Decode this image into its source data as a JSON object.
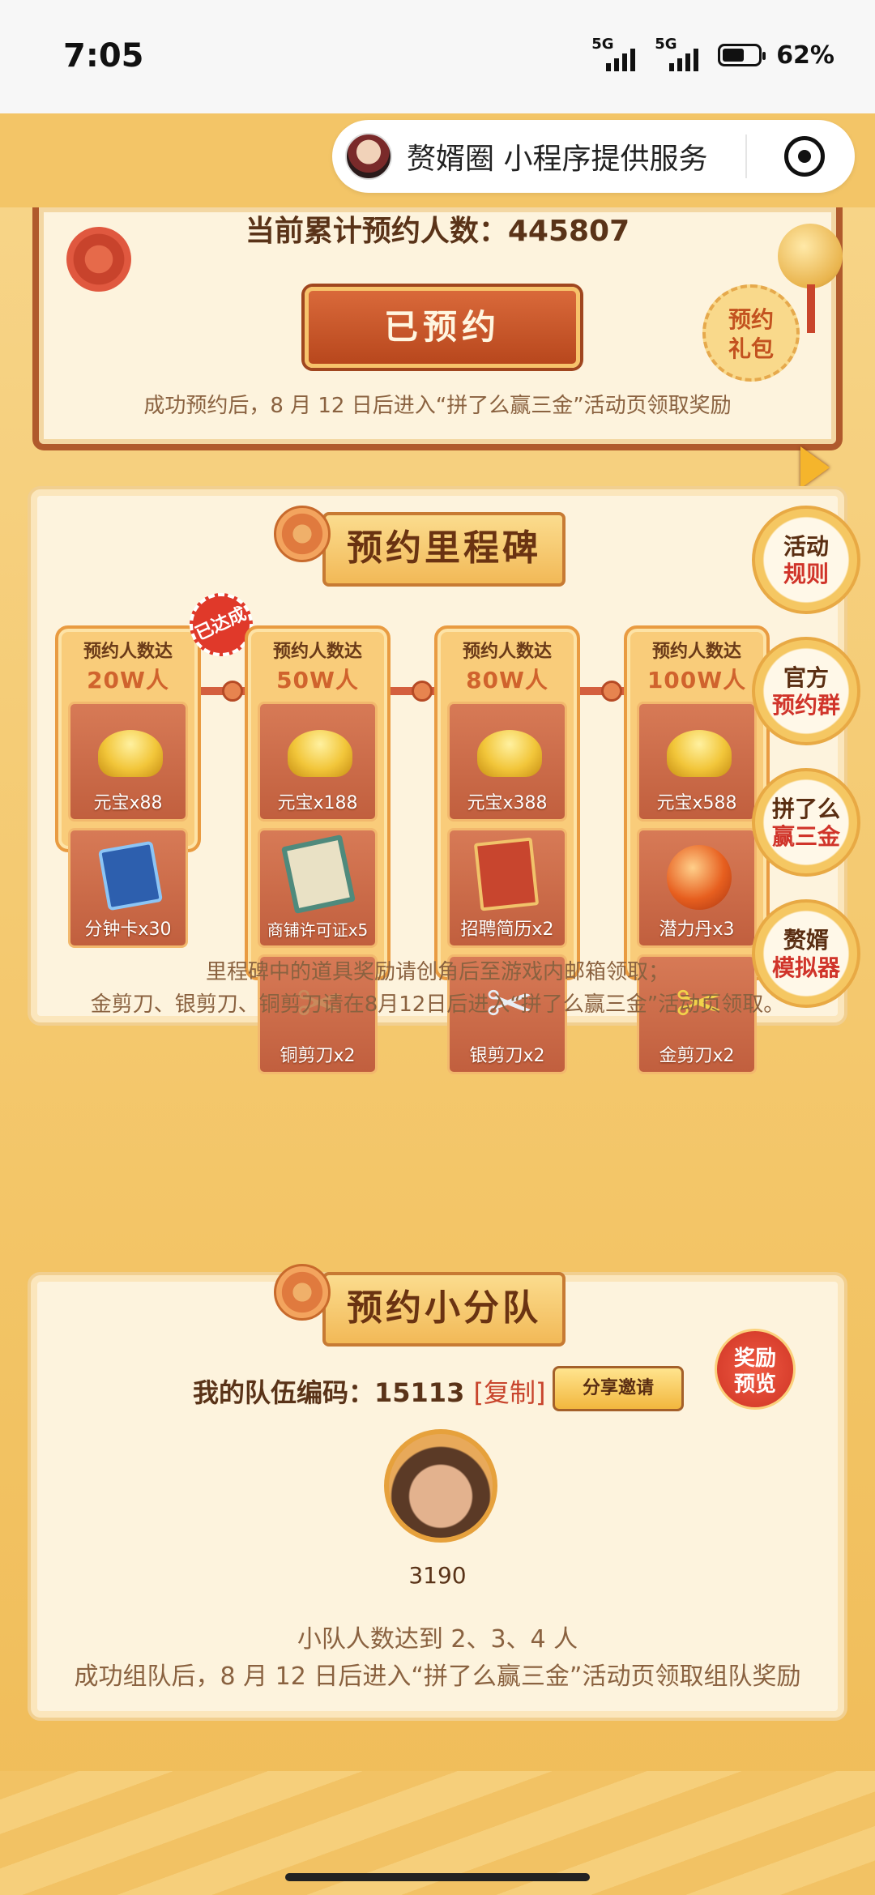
{
  "status_bar": {
    "time": "7:05",
    "signal1_label": "5G",
    "signal2_label": "5G",
    "battery_percent": "62%",
    "battery_level": 0.62
  },
  "mini_program": {
    "label": "赘婿圈 小程序提供服务"
  },
  "reservation": {
    "count_line": "当前累计预约人数：445807",
    "button_label": "已预约",
    "gift_badge_line1": "预约",
    "gift_badge_line2": "礼包",
    "note": "成功预约后，8 月 12 日后进入“拼了么赢三金”活动页领取奖励"
  },
  "milestone": {
    "title": "预约里程碑",
    "achieved_stamp": "已达成",
    "columns": [
      {
        "head_a": "预约人数达",
        "head_b": "20W人",
        "items": [
          {
            "icon": "gold-ingot-icon",
            "label": "元宝x88"
          },
          {
            "icon": "hourglass-card-icon",
            "label": "分钟卡x30"
          }
        ]
      },
      {
        "head_a": "预约人数达",
        "head_b": "50W人",
        "items": [
          {
            "icon": "gold-ingot-icon",
            "label": "元宝x188"
          },
          {
            "icon": "shop-license-icon",
            "label": "商铺许可证x5"
          },
          {
            "icon": "copper-scissors-icon",
            "label": "铜剪刀x2"
          }
        ]
      },
      {
        "head_a": "预约人数达",
        "head_b": "80W人",
        "items": [
          {
            "icon": "gold-ingot-icon",
            "label": "元宝x388"
          },
          {
            "icon": "resume-icon",
            "label": "招聘简历x2"
          },
          {
            "icon": "silver-scissors-icon",
            "label": "银剪刀x2"
          }
        ]
      },
      {
        "head_a": "预约人数达",
        "head_b": "100W人",
        "items": [
          {
            "icon": "gold-ingot-icon",
            "label": "元宝x588"
          },
          {
            "icon": "potential-pill-icon",
            "label": "潜力丹x3"
          },
          {
            "icon": "gold-scissors-icon",
            "label": "金剪刀x2"
          }
        ]
      }
    ],
    "note_line1": "里程碑中的道具奖励请创角后至游戏内邮箱领取；",
    "note_line2": "金剪刀、银剪刀、铜剪刀请在8月12日后进入“拼了么赢三金”活动页领取。"
  },
  "floating_buttons": [
    {
      "line1": "活动",
      "line2": "规则"
    },
    {
      "line1": "官方",
      "line2": "预约群"
    },
    {
      "line1": "拼了么",
      "line2": "赢三金"
    },
    {
      "line1": "赘婿",
      "line2": "模拟器"
    }
  ],
  "team": {
    "title": "预约小分队",
    "code_label": "我的队伍编码：15113",
    "copy_label": "[复制]",
    "share_label": "分享邀请",
    "reward_line1": "奖励",
    "reward_line2": "预览",
    "member_id": "3190",
    "note_line1": "小队人数达到 2、3、4 人",
    "note_line2": "成功组队后，8 月 12 日后进入“拼了么赢三金”活动页领取组队奖励"
  },
  "colors": {
    "accent": "#c8442c",
    "background": "#f3c567",
    "card": "#fdf3dd"
  }
}
